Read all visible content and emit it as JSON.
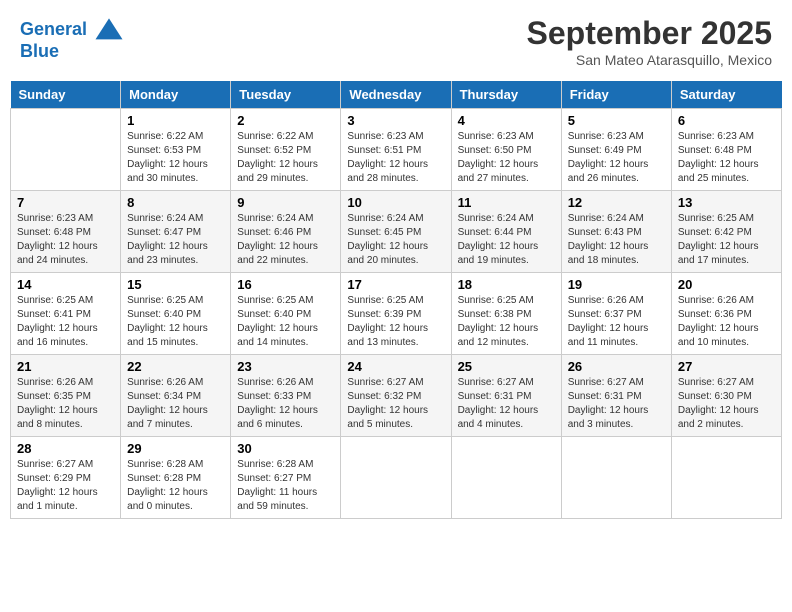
{
  "header": {
    "logo_line1": "General",
    "logo_line2": "Blue",
    "month": "September 2025",
    "location": "San Mateo Atarasquillo, Mexico"
  },
  "days_of_week": [
    "Sunday",
    "Monday",
    "Tuesday",
    "Wednesday",
    "Thursday",
    "Friday",
    "Saturday"
  ],
  "weeks": [
    [
      {
        "day": "",
        "info": ""
      },
      {
        "day": "1",
        "info": "Sunrise: 6:22 AM\nSunset: 6:53 PM\nDaylight: 12 hours\nand 30 minutes."
      },
      {
        "day": "2",
        "info": "Sunrise: 6:22 AM\nSunset: 6:52 PM\nDaylight: 12 hours\nand 29 minutes."
      },
      {
        "day": "3",
        "info": "Sunrise: 6:23 AM\nSunset: 6:51 PM\nDaylight: 12 hours\nand 28 minutes."
      },
      {
        "day": "4",
        "info": "Sunrise: 6:23 AM\nSunset: 6:50 PM\nDaylight: 12 hours\nand 27 minutes."
      },
      {
        "day": "5",
        "info": "Sunrise: 6:23 AM\nSunset: 6:49 PM\nDaylight: 12 hours\nand 26 minutes."
      },
      {
        "day": "6",
        "info": "Sunrise: 6:23 AM\nSunset: 6:48 PM\nDaylight: 12 hours\nand 25 minutes."
      }
    ],
    [
      {
        "day": "7",
        "info": "Sunrise: 6:23 AM\nSunset: 6:48 PM\nDaylight: 12 hours\nand 24 minutes."
      },
      {
        "day": "8",
        "info": "Sunrise: 6:24 AM\nSunset: 6:47 PM\nDaylight: 12 hours\nand 23 minutes."
      },
      {
        "day": "9",
        "info": "Sunrise: 6:24 AM\nSunset: 6:46 PM\nDaylight: 12 hours\nand 22 minutes."
      },
      {
        "day": "10",
        "info": "Sunrise: 6:24 AM\nSunset: 6:45 PM\nDaylight: 12 hours\nand 20 minutes."
      },
      {
        "day": "11",
        "info": "Sunrise: 6:24 AM\nSunset: 6:44 PM\nDaylight: 12 hours\nand 19 minutes."
      },
      {
        "day": "12",
        "info": "Sunrise: 6:24 AM\nSunset: 6:43 PM\nDaylight: 12 hours\nand 18 minutes."
      },
      {
        "day": "13",
        "info": "Sunrise: 6:25 AM\nSunset: 6:42 PM\nDaylight: 12 hours\nand 17 minutes."
      }
    ],
    [
      {
        "day": "14",
        "info": "Sunrise: 6:25 AM\nSunset: 6:41 PM\nDaylight: 12 hours\nand 16 minutes."
      },
      {
        "day": "15",
        "info": "Sunrise: 6:25 AM\nSunset: 6:40 PM\nDaylight: 12 hours\nand 15 minutes."
      },
      {
        "day": "16",
        "info": "Sunrise: 6:25 AM\nSunset: 6:40 PM\nDaylight: 12 hours\nand 14 minutes."
      },
      {
        "day": "17",
        "info": "Sunrise: 6:25 AM\nSunset: 6:39 PM\nDaylight: 12 hours\nand 13 minutes."
      },
      {
        "day": "18",
        "info": "Sunrise: 6:25 AM\nSunset: 6:38 PM\nDaylight: 12 hours\nand 12 minutes."
      },
      {
        "day": "19",
        "info": "Sunrise: 6:26 AM\nSunset: 6:37 PM\nDaylight: 12 hours\nand 11 minutes."
      },
      {
        "day": "20",
        "info": "Sunrise: 6:26 AM\nSunset: 6:36 PM\nDaylight: 12 hours\nand 10 minutes."
      }
    ],
    [
      {
        "day": "21",
        "info": "Sunrise: 6:26 AM\nSunset: 6:35 PM\nDaylight: 12 hours\nand 8 minutes."
      },
      {
        "day": "22",
        "info": "Sunrise: 6:26 AM\nSunset: 6:34 PM\nDaylight: 12 hours\nand 7 minutes."
      },
      {
        "day": "23",
        "info": "Sunrise: 6:26 AM\nSunset: 6:33 PM\nDaylight: 12 hours\nand 6 minutes."
      },
      {
        "day": "24",
        "info": "Sunrise: 6:27 AM\nSunset: 6:32 PM\nDaylight: 12 hours\nand 5 minutes."
      },
      {
        "day": "25",
        "info": "Sunrise: 6:27 AM\nSunset: 6:31 PM\nDaylight: 12 hours\nand 4 minutes."
      },
      {
        "day": "26",
        "info": "Sunrise: 6:27 AM\nSunset: 6:31 PM\nDaylight: 12 hours\nand 3 minutes."
      },
      {
        "day": "27",
        "info": "Sunrise: 6:27 AM\nSunset: 6:30 PM\nDaylight: 12 hours\nand 2 minutes."
      }
    ],
    [
      {
        "day": "28",
        "info": "Sunrise: 6:27 AM\nSunset: 6:29 PM\nDaylight: 12 hours\nand 1 minute."
      },
      {
        "day": "29",
        "info": "Sunrise: 6:28 AM\nSunset: 6:28 PM\nDaylight: 12 hours\nand 0 minutes."
      },
      {
        "day": "30",
        "info": "Sunrise: 6:28 AM\nSunset: 6:27 PM\nDaylight: 11 hours\nand 59 minutes."
      },
      {
        "day": "",
        "info": ""
      },
      {
        "day": "",
        "info": ""
      },
      {
        "day": "",
        "info": ""
      },
      {
        "day": "",
        "info": ""
      }
    ]
  ]
}
